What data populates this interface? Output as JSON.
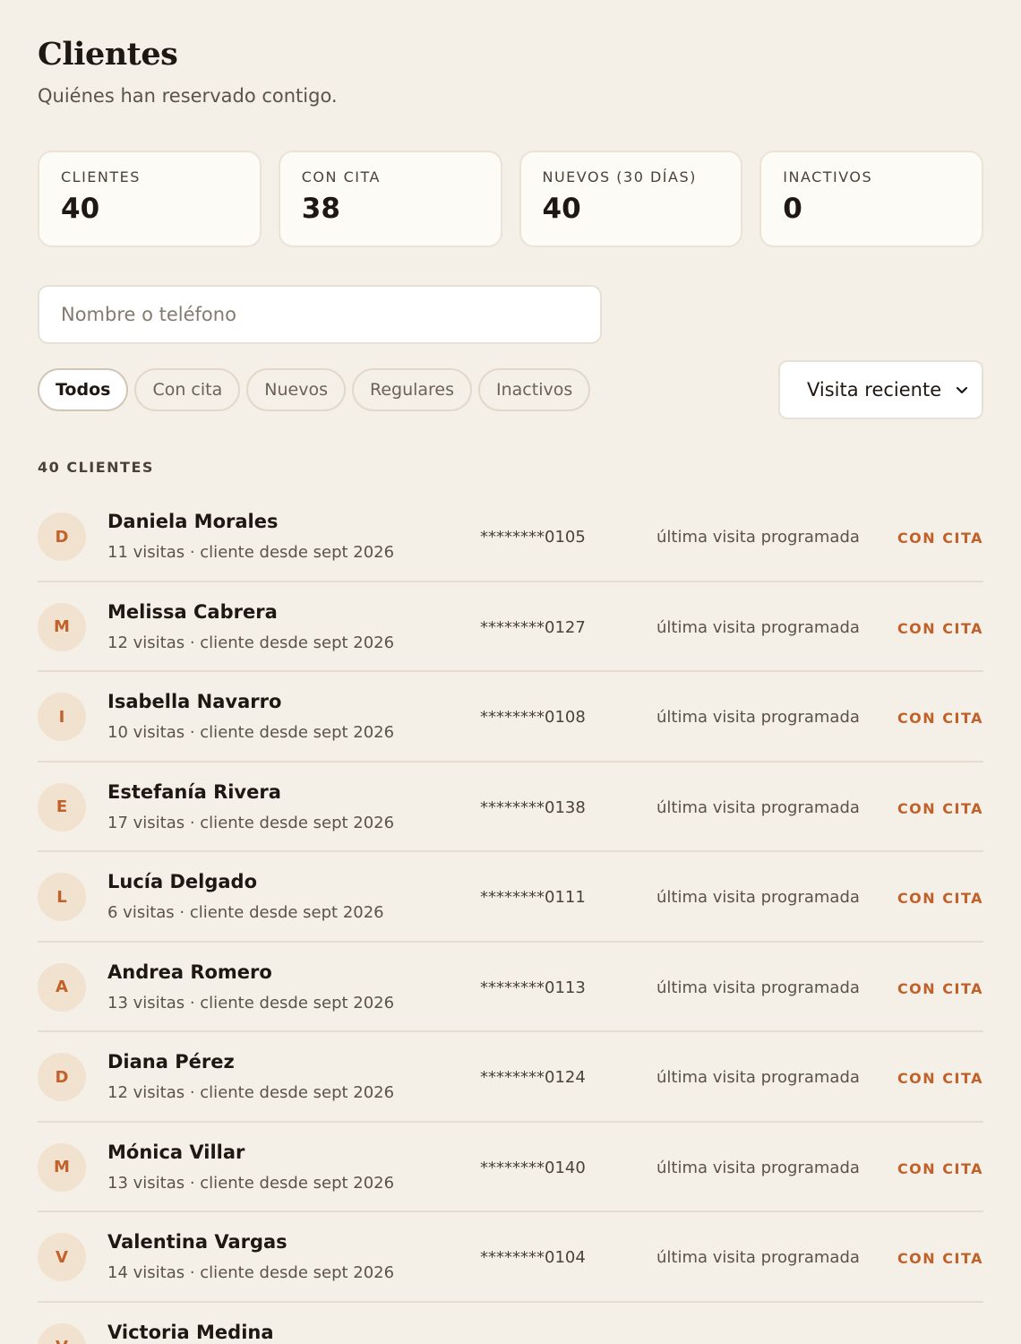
{
  "header": {
    "title": "Clientes",
    "subtitle": "Quiénes han reservado contigo."
  },
  "stats": [
    {
      "label": "CLIENTES",
      "value": "40"
    },
    {
      "label": "CON CITA",
      "value": "38"
    },
    {
      "label": "NUEVOS (30 DÍAS)",
      "value": "40"
    },
    {
      "label": "INACTIVOS",
      "value": "0"
    }
  ],
  "search": {
    "placeholder": "Nombre o teléfono",
    "value": ""
  },
  "filters": [
    "Todos",
    "Con cita",
    "Nuevos",
    "Regulares",
    "Inactivos"
  ],
  "active_filter": "Todos",
  "sort": {
    "label": "Visita reciente"
  },
  "count_label": "40 CLIENTES",
  "clients": [
    {
      "initial": "D",
      "name": "Daniela Morales",
      "meta": "11 visitas · cliente desde sept 2026",
      "phone": "********0105",
      "last": "última visita programada",
      "status": "CON CITA"
    },
    {
      "initial": "M",
      "name": "Melissa Cabrera",
      "meta": "12 visitas · cliente desde sept 2026",
      "phone": "********0127",
      "last": "última visita programada",
      "status": "CON CITA"
    },
    {
      "initial": "I",
      "name": "Isabella Navarro",
      "meta": "10 visitas · cliente desde sept 2026",
      "phone": "********0108",
      "last": "última visita programada",
      "status": "CON CITA"
    },
    {
      "initial": "E",
      "name": "Estefanía Rivera",
      "meta": "17 visitas · cliente desde sept 2026",
      "phone": "********0138",
      "last": "última visita programada",
      "status": "CON CITA"
    },
    {
      "initial": "L",
      "name": "Lucía Delgado",
      "meta": "6 visitas · cliente desde sept 2026",
      "phone": "********0111",
      "last": "última visita programada",
      "status": "CON CITA"
    },
    {
      "initial": "A",
      "name": "Andrea Romero",
      "meta": "13 visitas · cliente desde sept 2026",
      "phone": "********0113",
      "last": "última visita programada",
      "status": "CON CITA"
    },
    {
      "initial": "D",
      "name": "Diana Pérez",
      "meta": "12 visitas · cliente desde sept 2026",
      "phone": "********0124",
      "last": "última visita programada",
      "status": "CON CITA"
    },
    {
      "initial": "M",
      "name": "Mónica Villar",
      "meta": "13 visitas · cliente desde sept 2026",
      "phone": "********0140",
      "last": "última visita programada",
      "status": "CON CITA"
    },
    {
      "initial": "V",
      "name": "Valentina Vargas",
      "meta": "14 visitas · cliente desde sept 2026",
      "phone": "********0104",
      "last": "última visita programada",
      "status": "CON CITA"
    },
    {
      "initial": "V",
      "name": "Victoria Medina",
      "meta": "",
      "phone": "",
      "last": "",
      "status": ""
    }
  ],
  "colors": {
    "background": "#f5f0e7",
    "accent": "#c0612a",
    "avatar_bg": "#f1e1cf"
  }
}
